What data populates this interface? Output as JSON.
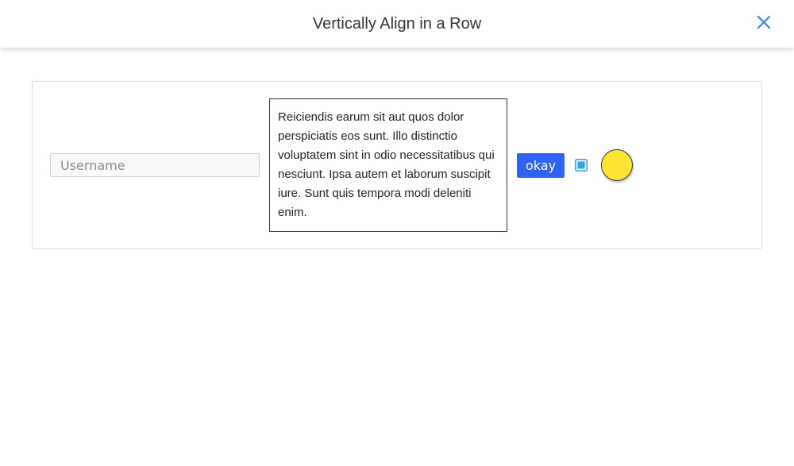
{
  "header": {
    "title": "Vertically Align in a Row",
    "close_icon": "close-icon",
    "close_color": "#4a90d9"
  },
  "form": {
    "username_placeholder": "Username",
    "username_value": "",
    "paragraph": "Reiciendis earum sit aut quos dolor perspiciatis eos sunt. Illo distinctio voluptatem sint in odio necessitatibus qui nesciunt. Ipsa autem et laborum suscipit iure. Sunt quis tempora modi deleniti enim.",
    "okay_label": "okay",
    "button_color": "#2f63f2",
    "checkbox_checked": true,
    "checkbox_color": "#3aa0e0",
    "circle_color": "#ffe533"
  }
}
